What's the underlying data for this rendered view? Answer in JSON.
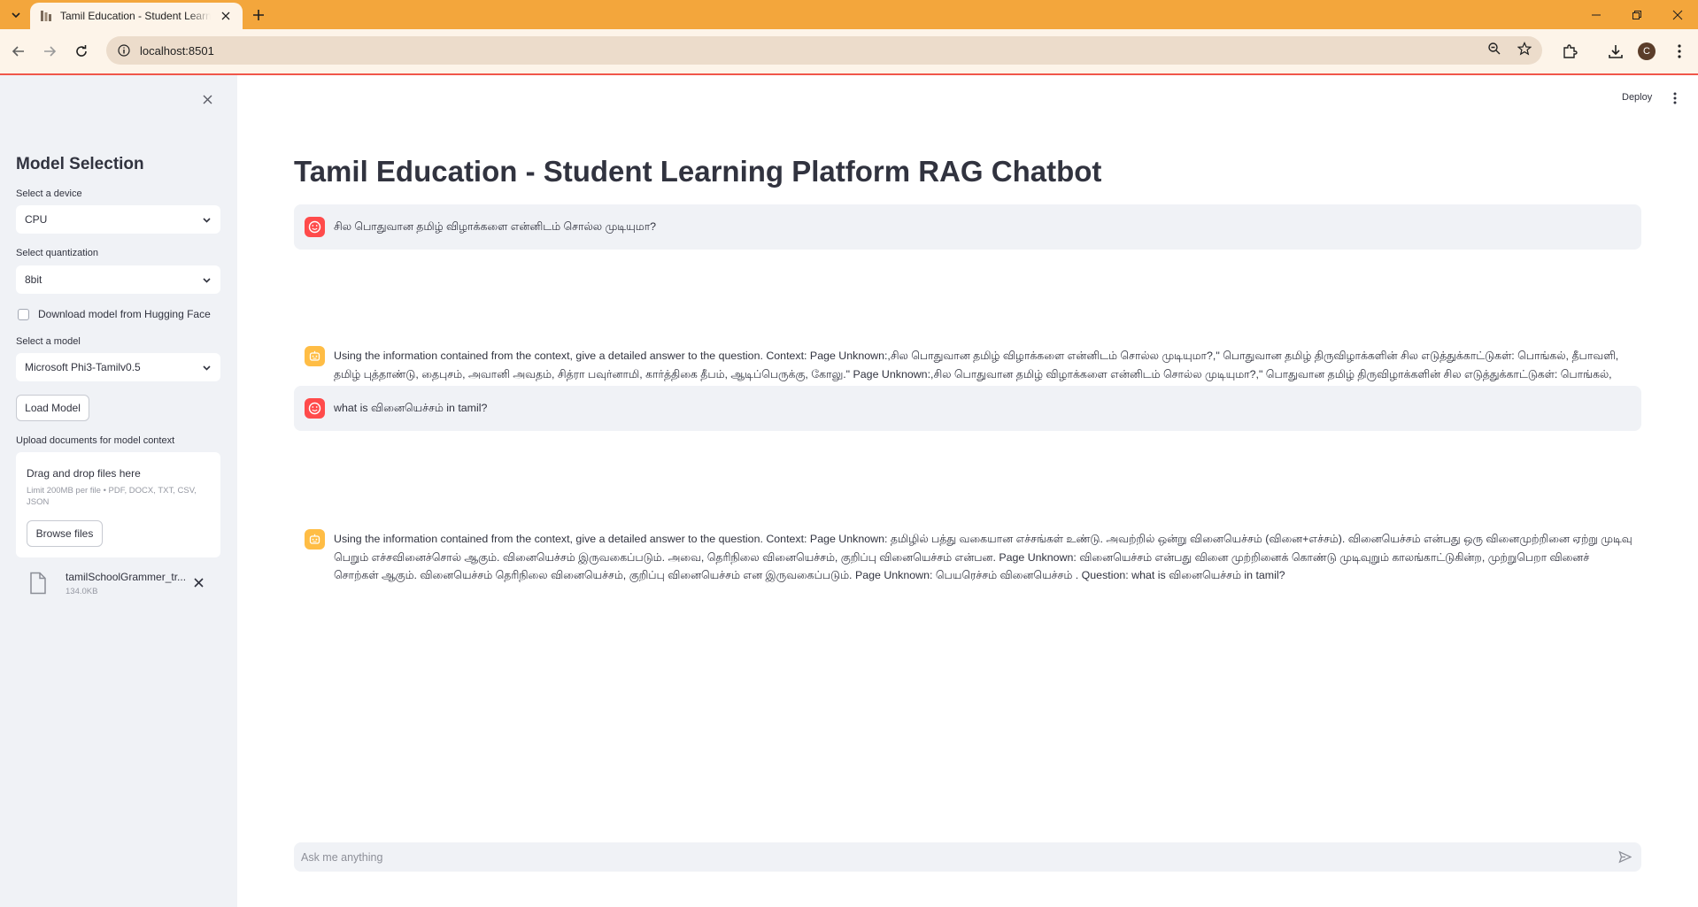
{
  "browser": {
    "tab_title": "Tamil Education - Student Learning Platform RAG Chatbot",
    "url": "localhost:8501",
    "profile_initial": "C"
  },
  "sidebar": {
    "heading": "Model Selection",
    "device_label": "Select a device",
    "device_value": "CPU",
    "quantization_label": "Select quantization",
    "quantization_value": "8bit",
    "download_checkbox_label": "Download model from Hugging Face",
    "model_label": "Select a model",
    "model_value": "Microsoft Phi3-Tamilv0.5",
    "load_button": "Load Model",
    "upload_label": "Upload documents for model context",
    "dropzone_title": "Drag and drop files here",
    "dropzone_limit": "Limit 200MB per file • PDF, DOCX, TXT, CSV, JSON",
    "browse_button": "Browse files",
    "uploaded_file_name": "tamilSchoolGrammer_tr...",
    "uploaded_file_size": "134.0KB"
  },
  "main": {
    "deploy_label": "Deploy",
    "title": "Tamil Education - Student Learning Platform RAG Chatbot",
    "messages": [
      {
        "role": "user",
        "text": "சில பொதுவான தமிழ் விழாக்களை என்னிடம் சொல்ல முடியுமா?"
      },
      {
        "role": "assistant",
        "text": "Using the information contained from the context, give a detailed answer to the question. Context: Page Unknown:,சில பொதுவான தமிழ் விழாக்களை என்னிடம் சொல்ல முடியுமா?,\" பொதுவான தமிழ் திருவிழாக்களின் சில எடுத்துக்காட்டுகள்: பொங்கல், தீபாவளி, தமிழ் புத்தாண்டு, தைபுசம், அவானி அவதம், சித்ரா பவுர்னாமி, கார்த்திகை தீபம், ஆடிப்பெருக்கு, கோலு.\" Page Unknown:,சில பொதுவான தமிழ் விழாக்களை என்னிடம் சொல்ல முடியுமா?,\" பொதுவான தமிழ் திருவிழாக்களின் சில எடுத்துக்காட்டுகள்: பொங்கல், தீபாவளி, தமிழ் புத்தாண்டு, தைபுசம், அவானி அவதம், சித்ரா பவுர்னாமி, கார்த்திகை தீபம், ஆடிப்பெருக்கு, கோலு.\" Page Unknown:,பொதுவான தமிழ் வினையுரிச்சொற்களின் சில எடுத்துக்காட்டுகளை என்னிடம் சொல்ல முடியுமா?,\" பொதுவான தமிழ் வினையுரிச்சொற்களின் சில எடுத்துக்காட்டுகள்: விரைவாக, மெதுவாக, மகிழ்ச்சியுடன், சோகமாக, அமைதியாக, சத்தமாக, கோபமாக, நன்றாக, மென்மையாக, மெதுவாக.\" . Question: சில பொதுவான தமிழ் விழாக்களை என்னிடம் சொல்ல முடியுமா?"
      },
      {
        "role": "user",
        "text": "what is வினையெச்சம் in tamil?"
      },
      {
        "role": "assistant",
        "text": "Using the information contained from the context, give a detailed answer to the question. Context: Page Unknown: தமிழில் பத்து வகையான எச்சங்கள் உண்டு. அவற்றில் ஒன்று வினையெச்சம் (வினை+எச்சம்). வினையெச்சம் என்பது ஒரு வினைமுற்றினை ஏற்று முடிவு பெறும் எச்சவினைச்சொல் ஆகும். வினையெச்சம் இருவகைப்படும். அவை, தெரிநிலை வினையெச்சம், குறிப்பு வினையெச்சம் என்பன. Page Unknown: வினையெச்சம் என்பது வினை முற்றினைக் கொண்டு முடிவுறும் காலங்காட்டுகின்ற, முற்றுபெறா வினைச் சொற்கள் ஆகும். வினையெச்சம் தெரிநிலை வினையெச்சம், குறிப்பு வினையெச்சம் என இருவகைப்படும். Page Unknown: பெயரெச்சம் வினையெச்சம் . Question: what is வினையெச்சம் in tamil?"
      }
    ],
    "chat_placeholder": "Ask me anything"
  },
  "colors": {
    "tabstrip": "#f3a63c",
    "toolbar": "#fdf4e9",
    "sidebar": "#f0f2f6",
    "user_avatar": "#ff4b4b",
    "assistant_avatar": "#ffbd45",
    "text": "#31333f"
  },
  "icons": {
    "user_avatar": "smiley-face-icon",
    "assistant_avatar": "robot-face-icon",
    "file": "document-icon",
    "send": "send-arrow-icon"
  }
}
